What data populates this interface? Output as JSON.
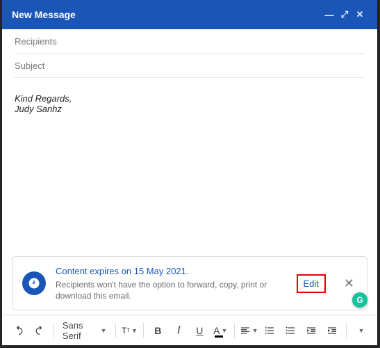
{
  "header": {
    "title": "New Message"
  },
  "fields": {
    "recipients_placeholder": "Recipients",
    "subject_placeholder": "Subject"
  },
  "body": {
    "signature_closing": "Kind Regards,",
    "signature_name": "Judy Sanhz"
  },
  "confidential": {
    "title": "Content expires on 15 May 2021.",
    "subtitle": "Recipients won't have the option to forward, copy, print or download this email.",
    "edit_label": "Edit"
  },
  "toolbar": {
    "font_name": "Sans Serif"
  },
  "grammarly": {
    "glyph": "G"
  }
}
